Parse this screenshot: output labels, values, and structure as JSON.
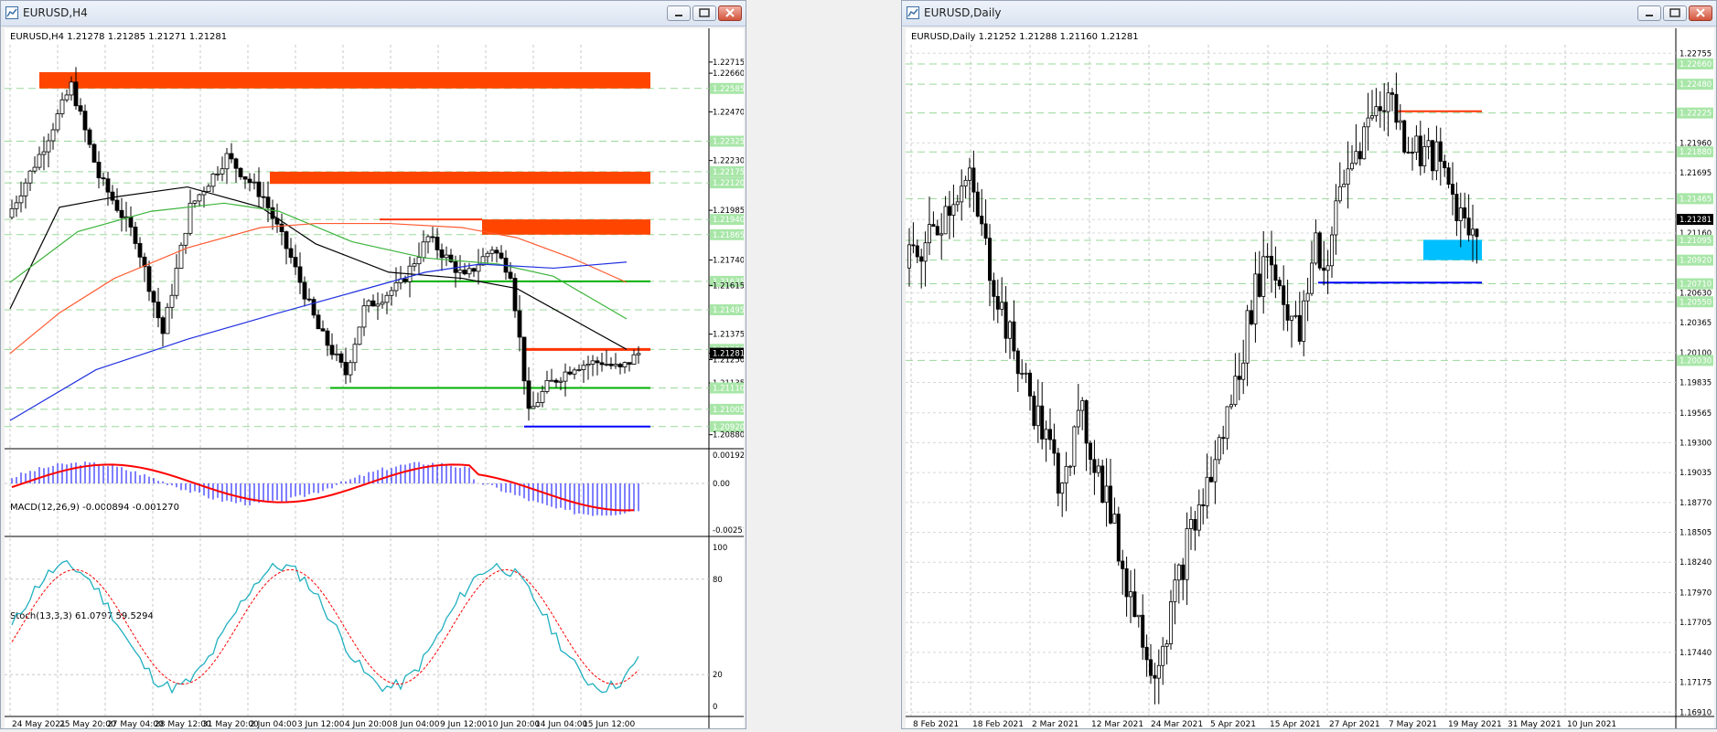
{
  "left_window": {
    "title": "EURUSD,H4",
    "info": "EURUSD,H4  1.21278 1.21285 1.21271 1.21281",
    "price_labels": [
      "1.22715",
      "1.22660",
      "1.22585",
      "1.22470",
      "1.22325",
      "1.22230",
      "1.22175",
      "1.22120",
      "1.21985",
      "1.21940",
      "1.21865",
      "1.21740",
      "1.21635",
      "1.21615",
      "1.21495",
      "1.21375",
      "1.21300",
      "1.21281",
      "1.21250",
      "1.21135",
      "1.21110",
      "1.21005",
      "1.20920",
      "1.20880"
    ],
    "macd_label": "MACD(12,26,9) -0.000894 -0.001270",
    "macd_scale": [
      "0.001927",
      "0.00",
      "-0.00251"
    ],
    "stoch_label": "Stoch(13,3,3) 61.0797 59.5294",
    "stoch_scale": [
      "100",
      "80",
      "20",
      "0"
    ],
    "time_labels": [
      "24 May 2021",
      "25 May 20:00",
      "27 May 04:00",
      "28 May 12:00",
      "31 May 20:00",
      "2 Jun 04:00",
      "3 Jun 12:00",
      "4 Jun 20:00",
      "8 Jun 04:00",
      "9 Jun 12:00",
      "10 Jun 20:00",
      "14 Jun 04:00",
      "15 Jun 12:00"
    ]
  },
  "right_window": {
    "title": "EURUSD,Daily",
    "info": "EURUSD,Daily  1.21252 1.21288 1.21160 1.21281",
    "price_labels": [
      "1.22755",
      "1.22660",
      "1.22480",
      "1.22225",
      "1.21960",
      "1.21880",
      "1.21695",
      "1.21465",
      "1.21281",
      "1.21160",
      "1.21095",
      "1.20920",
      "1.20710",
      "1.20630",
      "1.20550",
      "1.20365",
      "1.20100",
      "1.20030",
      "1.19835",
      "1.19565",
      "1.19300",
      "1.19035",
      "1.18770",
      "1.18505",
      "1.18240",
      "1.17970",
      "1.17705",
      "1.17440",
      "1.17175",
      "1.16910"
    ],
    "time_labels": [
      "8 Feb 2021",
      "18 Feb 2021",
      "2 Mar 2021",
      "12 Mar 2021",
      "24 Mar 2021",
      "5 Apr 2021",
      "15 Apr 2021",
      "27 Apr 2021",
      "7 May 2021",
      "19 May 2021",
      "31 May 2021",
      "10 Jun 2021"
    ]
  },
  "colors": {
    "bull": "#000000",
    "bear": "#000000",
    "bg": "#ffffff",
    "resistance_zone": "#ff4500",
    "support_zone": "#00bfff",
    "green_level": "#00b000",
    "blue_level": "#0000ff",
    "red_level": "#ff3300",
    "ma_black": "#000000",
    "ma_green": "#3cb43c",
    "ma_red": "#ff5a30",
    "ma_blue": "#2030e0",
    "macd_signal": "#ff0000",
    "macd_hist": "#0000ff",
    "stoch_main": "#20b0c0",
    "stoch_signal": "#ff0000",
    "label_green": "#a8e6a8"
  }
}
